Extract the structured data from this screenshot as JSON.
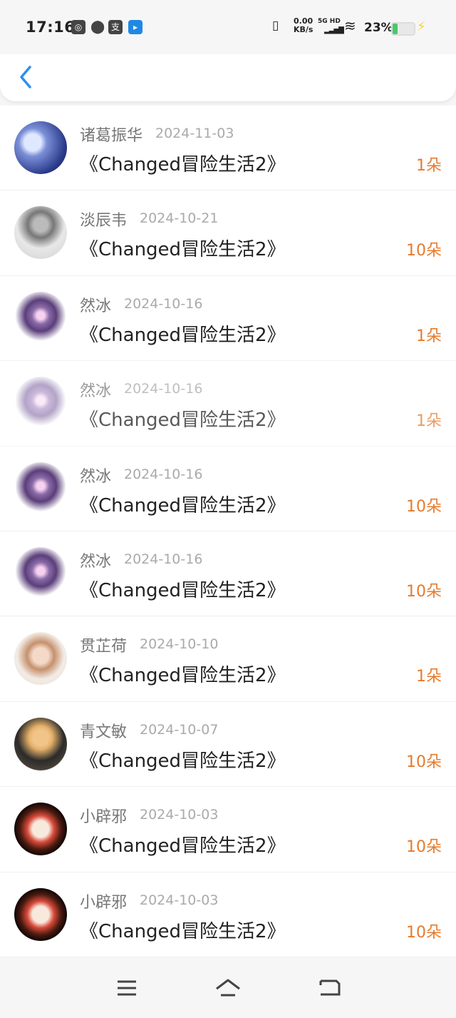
{
  "status_bar": {
    "time": "17:16",
    "network_speed": "0.00",
    "network_unit": "KB/s",
    "network_type": "5G HD",
    "battery": "23%"
  },
  "list": [
    {
      "name": "诸葛振华",
      "date": "2024-11-03",
      "title": "《Changed冒险生活2》",
      "amount": "1朵",
      "avatar": "anime-couple"
    },
    {
      "name": "淡辰韦",
      "date": "2024-10-21",
      "title": "《Changed冒险生活2》",
      "amount": "10朵",
      "avatar": "grayscale-portrait"
    },
    {
      "name": "然冰",
      "date": "2024-10-16",
      "title": "《Changed冒险生活2》",
      "amount": "1朵",
      "avatar": "purple-creature"
    },
    {
      "name": "然冰",
      "date": "2024-10-16",
      "title": "《Changed冒险生活2》",
      "amount": "1朵",
      "avatar": "purple-creature-faded"
    },
    {
      "name": "然冰",
      "date": "2024-10-16",
      "title": "《Changed冒险生活2》",
      "amount": "10朵",
      "avatar": "purple-creature"
    },
    {
      "name": "然冰",
      "date": "2024-10-16",
      "title": "《Changed冒险生活2》",
      "amount": "10朵",
      "avatar": "purple-creature"
    },
    {
      "name": "贯芷荷",
      "date": "2024-10-10",
      "title": "《Changed冒险生活2》",
      "amount": "1朵",
      "avatar": "girl-photo"
    },
    {
      "name": "青文敏",
      "date": "2024-10-07",
      "title": "《Changed冒险生活2》",
      "amount": "10朵",
      "avatar": "boy-photo"
    },
    {
      "name": "小辟邪",
      "date": "2024-10-03",
      "title": "《Changed冒险生活2》",
      "amount": "10朵",
      "avatar": "fox-mask"
    },
    {
      "name": "小辟邪",
      "date": "2024-10-03",
      "title": "《Changed冒险生活2》",
      "amount": "10朵",
      "avatar": "fox-mask"
    }
  ],
  "colors": {
    "accent": "#2d8ff0",
    "amount": "#e77a2b"
  }
}
